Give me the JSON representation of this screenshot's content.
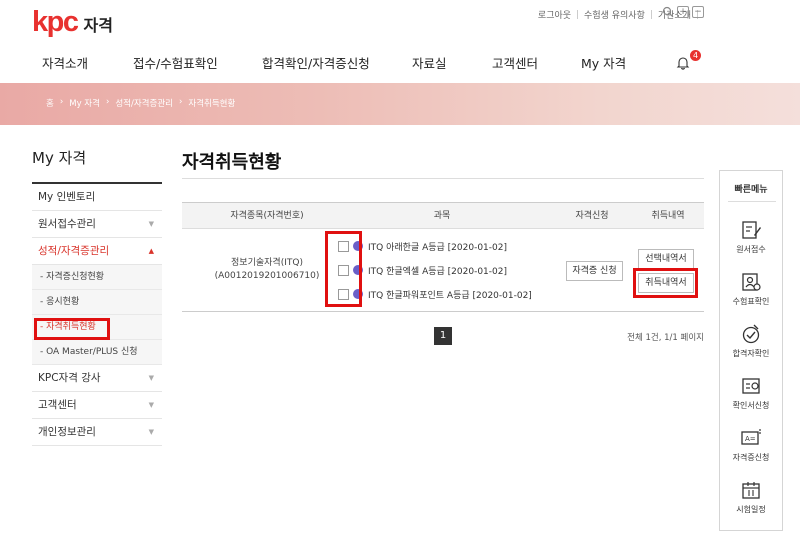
{
  "header": {
    "logo_mark": "kpc",
    "logo_text": "자격",
    "util_links": [
      "로그아웃",
      "수험생 유의사항",
      "기관소개"
    ],
    "nav": [
      "자격소개",
      "접수/수험표확인",
      "합격확인/자격증신청",
      "자료실",
      "고객센터",
      "My 자격"
    ],
    "notification_count": "4"
  },
  "breadcrumb": [
    "홈",
    "My 자격",
    "성적/자격증관리",
    "자격취득현황"
  ],
  "sidebar": {
    "title": "My 자격",
    "items": [
      {
        "label": "My 인벤토리"
      },
      {
        "label": "원서접수관리"
      },
      {
        "label": "성적/자격증관리"
      },
      {
        "label": "KPC자격 강사"
      },
      {
        "label": "고객센터"
      },
      {
        "label": "개인정보관리"
      }
    ],
    "sub_items": [
      {
        "label": "- 자격증신청현황"
      },
      {
        "label": "- 응시현황"
      },
      {
        "label": "- 자격취득현황"
      },
      {
        "label": "- OA Master/PLUS 신청"
      }
    ]
  },
  "main": {
    "title": "자격취득현황",
    "columns": [
      "자격종목(자격번호)",
      "과목",
      "자격신청",
      "취득내역"
    ],
    "record": {
      "cert_name": "정보기술자격(ITQ)",
      "cert_number": "(A0012019201006710)",
      "subjects": [
        {
          "label": "ITQ 아래한글 A등급 [2020-01-02]"
        },
        {
          "label": "ITQ 한글엑셀 A등급 [2020-01-02]"
        },
        {
          "label": "ITQ 한글파워포인트 A등급 [2020-01-02]"
        }
      ],
      "apply_button": "자격증 신청",
      "select_history_button": "선택내역서",
      "history_button": "취득내역서"
    },
    "pagination": {
      "current": "1"
    },
    "total_text": "전체 1건, 1/1 페이지"
  },
  "quick_menu": {
    "title": "빠른메뉴",
    "items": [
      {
        "label": "원서접수",
        "icon": "pencil-form-icon"
      },
      {
        "label": "수험표확인",
        "icon": "id-card-icon"
      },
      {
        "label": "합격자확인",
        "icon": "medal-icon"
      },
      {
        "label": "확인서신청",
        "icon": "certificate-icon"
      },
      {
        "label": "자격증신청",
        "icon": "license-card-icon"
      },
      {
        "label": "시험일정",
        "icon": "calendar-icon"
      }
    ]
  },
  "colors": {
    "brand": "#e8312f",
    "highlight": "#e01010",
    "accent_dot": "#6a5fc8"
  }
}
